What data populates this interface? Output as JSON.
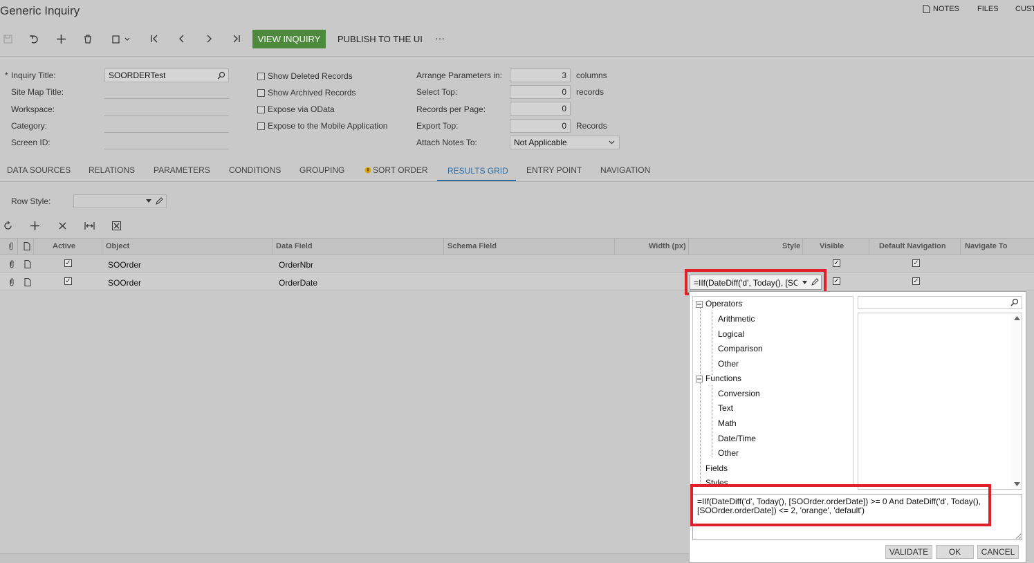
{
  "header": {
    "title": "Generic Inquiry",
    "notes": "NOTES",
    "files": "FILES",
    "customization": "CUST"
  },
  "toolbar": {
    "view_inquiry": "VIEW INQUIRY",
    "publish": "PUBLISH TO THE UI",
    "more": "···"
  },
  "form": {
    "inquiry_title_label": "Inquiry Title:",
    "inquiry_title_value": "SOORDERTest",
    "site_map_title_label": "Site Map Title:",
    "workspace_label": "Workspace:",
    "category_label": "Category:",
    "screen_id_label": "Screen ID:",
    "required_mark": "*",
    "show_deleted": "Show Deleted Records",
    "show_archived": "Show Archived Records",
    "expose_odata": "Expose via OData",
    "expose_mobile": "Expose to the Mobile Application",
    "arrange_label": "Arrange Parameters in:",
    "arrange_value": "3",
    "arrange_unit": "columns",
    "select_top_label": "Select Top:",
    "select_top_value": "0",
    "select_top_unit": "records",
    "records_per_page_label": "Records per Page:",
    "records_per_page_value": "0",
    "export_top_label": "Export Top:",
    "export_top_value": "0",
    "export_top_unit": "Records",
    "attach_notes_label": "Attach Notes To:",
    "attach_notes_value": "Not Applicable"
  },
  "tabs": {
    "data_sources": "DATA SOURCES",
    "relations": "RELATIONS",
    "parameters": "PARAMETERS",
    "conditions": "CONDITIONS",
    "grouping": "GROUPING",
    "sort_order": "SORT ORDER",
    "results_grid": "RESULTS GRID",
    "entry_point": "ENTRY POINT",
    "navigation": "NAVIGATION"
  },
  "row_style": {
    "label": "Row Style:"
  },
  "grid": {
    "columns": {
      "active": "Active",
      "object": "Object",
      "data_field": "Data Field",
      "schema_field": "Schema Field",
      "width": "Width (px)",
      "style": "Style",
      "visible": "Visible",
      "default_navigation": "Default Navigation",
      "navigate_to": "Navigate To"
    },
    "rows": [
      {
        "object": "SOOrder",
        "data_field": "OrderNbr",
        "style": ""
      },
      {
        "object": "SOOrder",
        "data_field": "OrderDate",
        "style": "=IIf(DateDiff('d', Today(), [SOO"
      }
    ]
  },
  "formula_editor": {
    "tree": {
      "operators": "Operators",
      "arithmetic": "Arithmetic",
      "logical": "Logical",
      "comparison": "Comparison",
      "operators_other": "Other",
      "functions": "Functions",
      "conversion": "Conversion",
      "text": "Text",
      "math": "Math",
      "datetime": "Date/Time",
      "functions_other": "Other",
      "fields": "Fields",
      "styles": "Styles"
    },
    "expression": "=IIf(DateDiff('d', Today(), [SOOrder.orderDate]) >= 0 And DateDiff('d', Today(), [SOOrder.orderDate]) <= 2, 'orange', 'default')",
    "validate": "VALIDATE",
    "ok": "OK",
    "cancel": "CANCEL"
  },
  "colors": {
    "accent_green": "#4d8a3c",
    "tab_active": "#2a6ea8",
    "highlight_red": "#e0202a"
  }
}
